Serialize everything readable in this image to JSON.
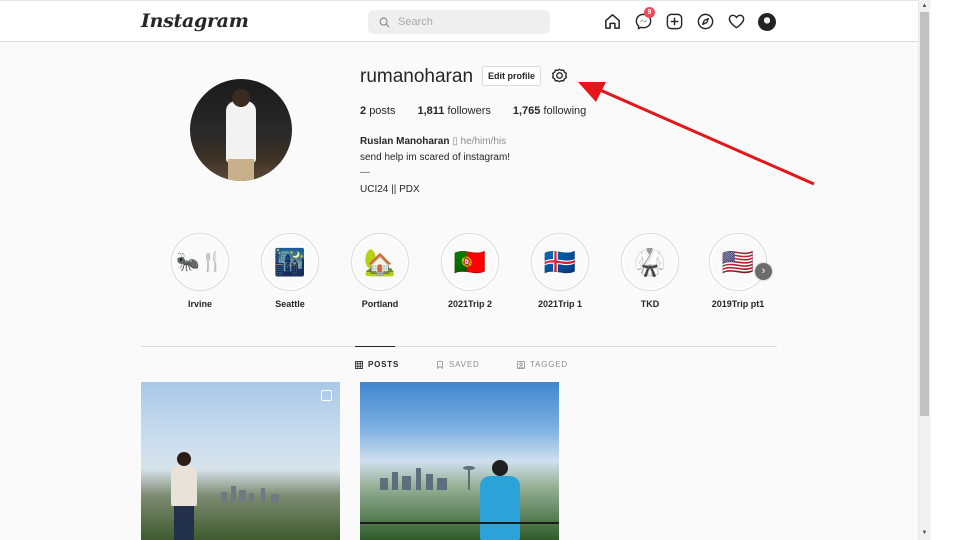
{
  "nav": {
    "logo": "Instagram",
    "search_placeholder": "Search",
    "messenger_badge": "9",
    "icons": [
      "home-icon",
      "messenger-icon",
      "new-post-icon",
      "explore-icon",
      "activity-heart-icon",
      "profile-avatar"
    ]
  },
  "profile": {
    "username": "rumanoharan",
    "edit_label": "Edit profile",
    "stats": [
      {
        "value": "2",
        "label": "posts"
      },
      {
        "value": "1,811",
        "label": "followers"
      },
      {
        "value": "1,765",
        "label": "following"
      }
    ],
    "full_name": "Ruslan Manoharan",
    "name_glyph": "▯",
    "pronouns": "he/him/his",
    "bio": [
      "send help im scared of instagram!",
      "—",
      "UCI24 || PDX"
    ]
  },
  "highlights": [
    {
      "label": "Irvine",
      "emoji": "🐜🍴"
    },
    {
      "label": "Seattle",
      "emoji": "🌃"
    },
    {
      "label": "Portland",
      "emoji": "🏡"
    },
    {
      "label": "2021Trip 2",
      "emoji": "🇵🇹"
    },
    {
      "label": "2021Trip 1",
      "emoji": "🇮🇸"
    },
    {
      "label": "TKD",
      "emoji": "🥋"
    },
    {
      "label": "2019Trip pt1",
      "emoji": "🇺🇸"
    }
  ],
  "tabs": [
    {
      "label": "POSTS",
      "active": true
    },
    {
      "label": "SAVED",
      "active": false
    },
    {
      "label": "TAGGED",
      "active": false
    }
  ],
  "colors": {
    "annotation_arrow": "#e3161b",
    "badge": "#ed4956",
    "border": "#dbdbdb"
  }
}
